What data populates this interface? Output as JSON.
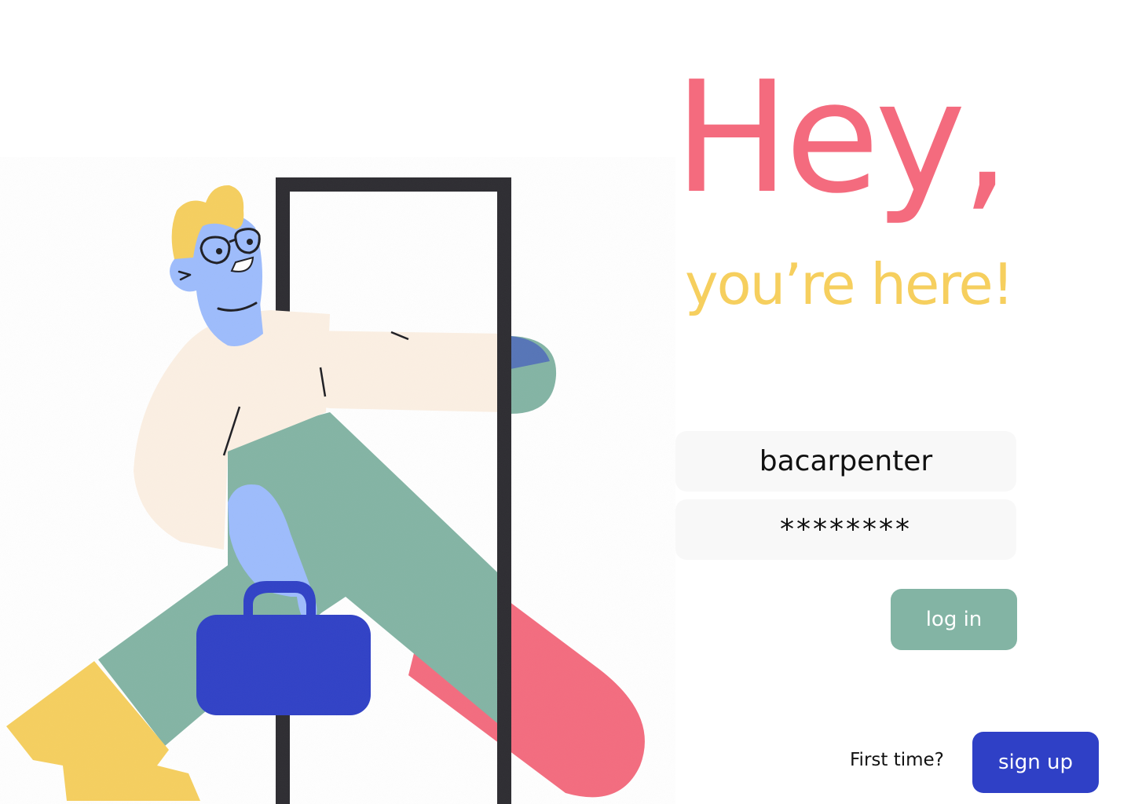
{
  "greeting": {
    "title": "Hey,",
    "subtitle": "you’re here!"
  },
  "login_form": {
    "username_value": "bacarpenter",
    "password_value": "********",
    "login_label": "log in"
  },
  "signup": {
    "prompt": "First time?",
    "button_label": "sign up"
  },
  "colors": {
    "title_pink": "#f46b7e",
    "subtitle_yellow": "#f6cf5e",
    "login_green": "#83b4a4",
    "signup_blue": "#2f40c6",
    "field_background": "#f8f8f8"
  },
  "illustration": {
    "subject": "person-walking-through-door-icon"
  }
}
